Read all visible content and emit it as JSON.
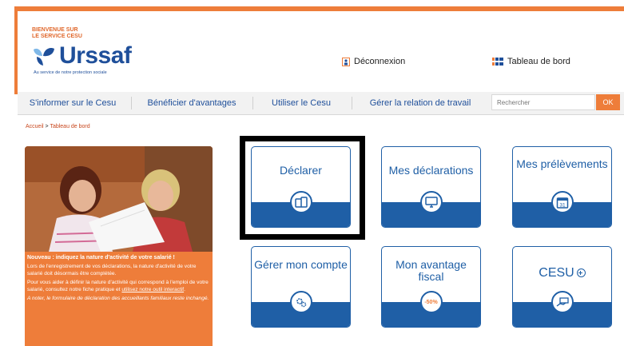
{
  "header": {
    "welcome_line1": "BIENVENUE SUR",
    "welcome_line2": "LE SERVICE CESU",
    "logo_text": "Urssaf",
    "logo_tagline": "Au service de notre protection sociale",
    "logout_label": "Déconnexion",
    "dashboard_label": "Tableau de bord"
  },
  "nav": {
    "items": [
      {
        "label": "S'informer sur le Cesu"
      },
      {
        "label": "Bénéficier d'avantages"
      },
      {
        "label": "Utiliser le Cesu"
      },
      {
        "label": "Gérer la relation de travail"
      }
    ],
    "search_placeholder": "Rechercher",
    "ok_label": "OK"
  },
  "breadcrumb": {
    "home": "Accueil",
    "separator": " > ",
    "current": "Tableau de bord"
  },
  "promo": {
    "headline": "Nouveau : indiquez la nature d'activité de votre salarié !",
    "para1": "Lors de l'enregistrement de vos déclarations, la nature d'activité de votre salarié doit désormais être complétée.",
    "para2_text": "Pour vous aider à définir la nature d'activité qui correspond à l'emploi de votre salarié, consultez notre fiche pratique et ",
    "para2_link": "utilisez notre outil interactif",
    "para2_end": ".",
    "note": "A noter, le formulaire de déclaration des accueillants familiaux reste inchangé."
  },
  "tiles": [
    {
      "label": "Déclarer",
      "icon": "devices-icon"
    },
    {
      "label": "Mes déclarations",
      "icon": "monitor-icon"
    },
    {
      "label": "Mes prélèvements",
      "icon": "calendar-icon",
      "icon_text": "31"
    },
    {
      "label": "Gérer mon compte",
      "icon": "gears-icon"
    },
    {
      "label": "Mon avantage fiscal",
      "icon": "percent-icon",
      "icon_text": "-50%"
    },
    {
      "label": "CESU",
      "icon": "money-hand-icon"
    }
  ],
  "colors": {
    "orange": "#ee7d3a",
    "blue": "#1f5fa6",
    "dark_blue": "#1f4f9a"
  }
}
